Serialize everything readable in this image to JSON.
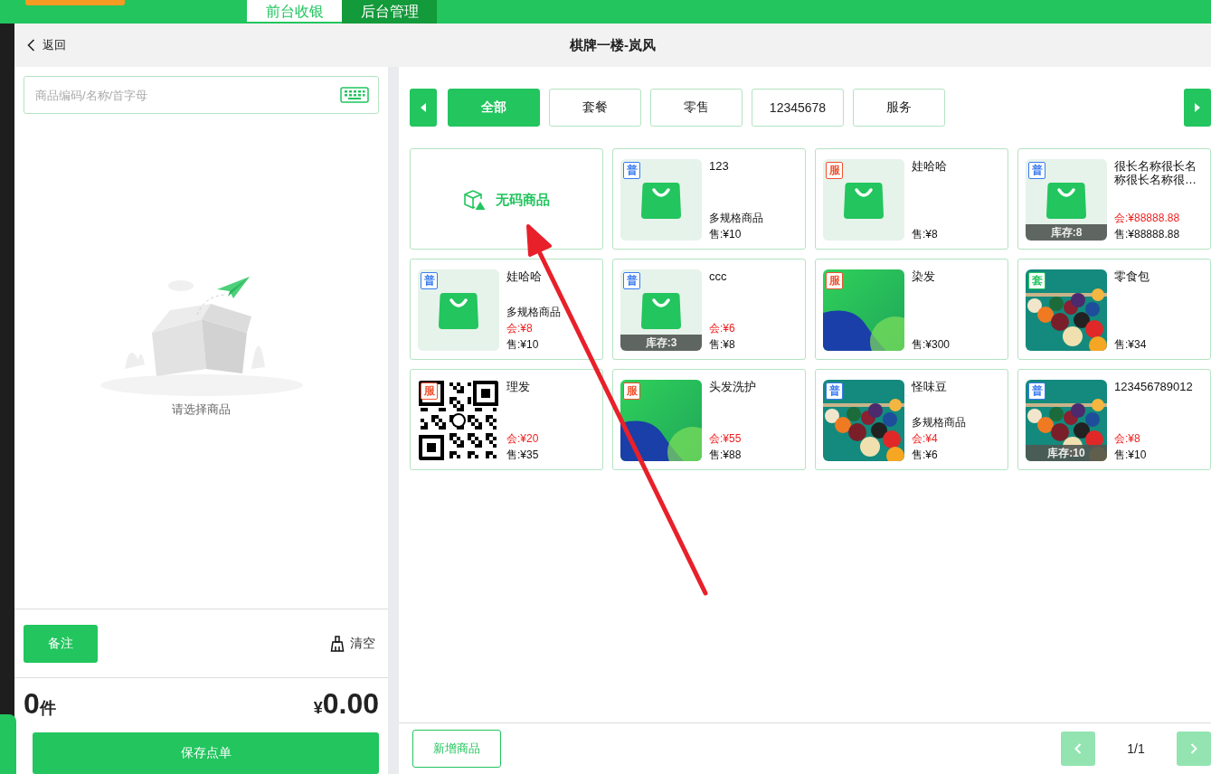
{
  "top_bar": {
    "tabs": [
      {
        "label": "前台收银",
        "selected": true
      },
      {
        "label": "后台管理",
        "selected": false
      }
    ]
  },
  "header": {
    "back": "返回",
    "title": "棋牌一楼-岚风"
  },
  "cart": {
    "search": {
      "placeholder": "商品编码/名称/首字母"
    },
    "empty_text": "请选择商品",
    "note_button": "备注",
    "clear_button": "清空",
    "count": "0",
    "count_unit": "件",
    "currency": "¥",
    "total": "0.00",
    "save_button": "保存点单"
  },
  "categories": [
    {
      "label": "全部",
      "selected": true
    },
    {
      "label": "套餐",
      "selected": false
    },
    {
      "label": "零售",
      "selected": false
    },
    {
      "label": "12345678",
      "selected": false
    },
    {
      "label": "服务",
      "selected": false
    }
  ],
  "products": [
    {
      "kind": "no-code",
      "name": "无码商品"
    },
    {
      "kind": "bag",
      "tag": "普",
      "color": "#3a7bf0",
      "name": "123",
      "spec": "多规格商品",
      "sale": "售:¥10"
    },
    {
      "kind": "bag",
      "tag": "服",
      "color": "#f0522e",
      "name": "娃哈哈",
      "sale": "售:¥8"
    },
    {
      "kind": "bag",
      "tag": "普",
      "color": "#3a7bf0",
      "name": "很长名称很长名称很长名称很…",
      "member": "会:¥88888.88",
      "sale": "售:¥88888.88",
      "stock": "库存:8"
    },
    {
      "kind": "bag",
      "tag": "普",
      "color": "#3a7bf0",
      "name": "娃哈哈",
      "spec": "多规格商品",
      "member": "会:¥8",
      "sale": "售:¥10"
    },
    {
      "kind": "bag",
      "tag": "普",
      "color": "#3a7bf0",
      "name": "ccc",
      "member": "会:¥6",
      "sale": "售:¥8",
      "stock": "库存:3"
    },
    {
      "kind": "poster",
      "tag": "服",
      "color": "#f0522e",
      "name": "染发",
      "sale": "售:¥300"
    },
    {
      "kind": "billiards",
      "tag": "套",
      "color": "#22c55e",
      "name": "零食包",
      "sale": "售:¥34"
    },
    {
      "kind": "qrcode",
      "tag": "服",
      "color": "#f0522e",
      "name": "理发",
      "member": "会:¥20",
      "sale": "售:¥35"
    },
    {
      "kind": "poster",
      "tag": "服",
      "color": "#f0522e",
      "name": "头发洗护",
      "member": "会:¥55",
      "sale": "售:¥88"
    },
    {
      "kind": "billiards",
      "tag": "普",
      "color": "#3a7bf0",
      "name": "怪味豆",
      "spec": "多规格商品",
      "member": "会:¥4",
      "sale": "售:¥6"
    },
    {
      "kind": "billiards",
      "tag": "普",
      "color": "#3a7bf0",
      "name": "123456789012",
      "member": "会:¥8",
      "sale": "售:¥10",
      "stock": "库存:10"
    }
  ],
  "footer": {
    "add_button": "新增商品",
    "pager": {
      "prev": {
        "disabled": true
      },
      "page": "1/1",
      "next": {
        "disabled": true
      }
    }
  }
}
